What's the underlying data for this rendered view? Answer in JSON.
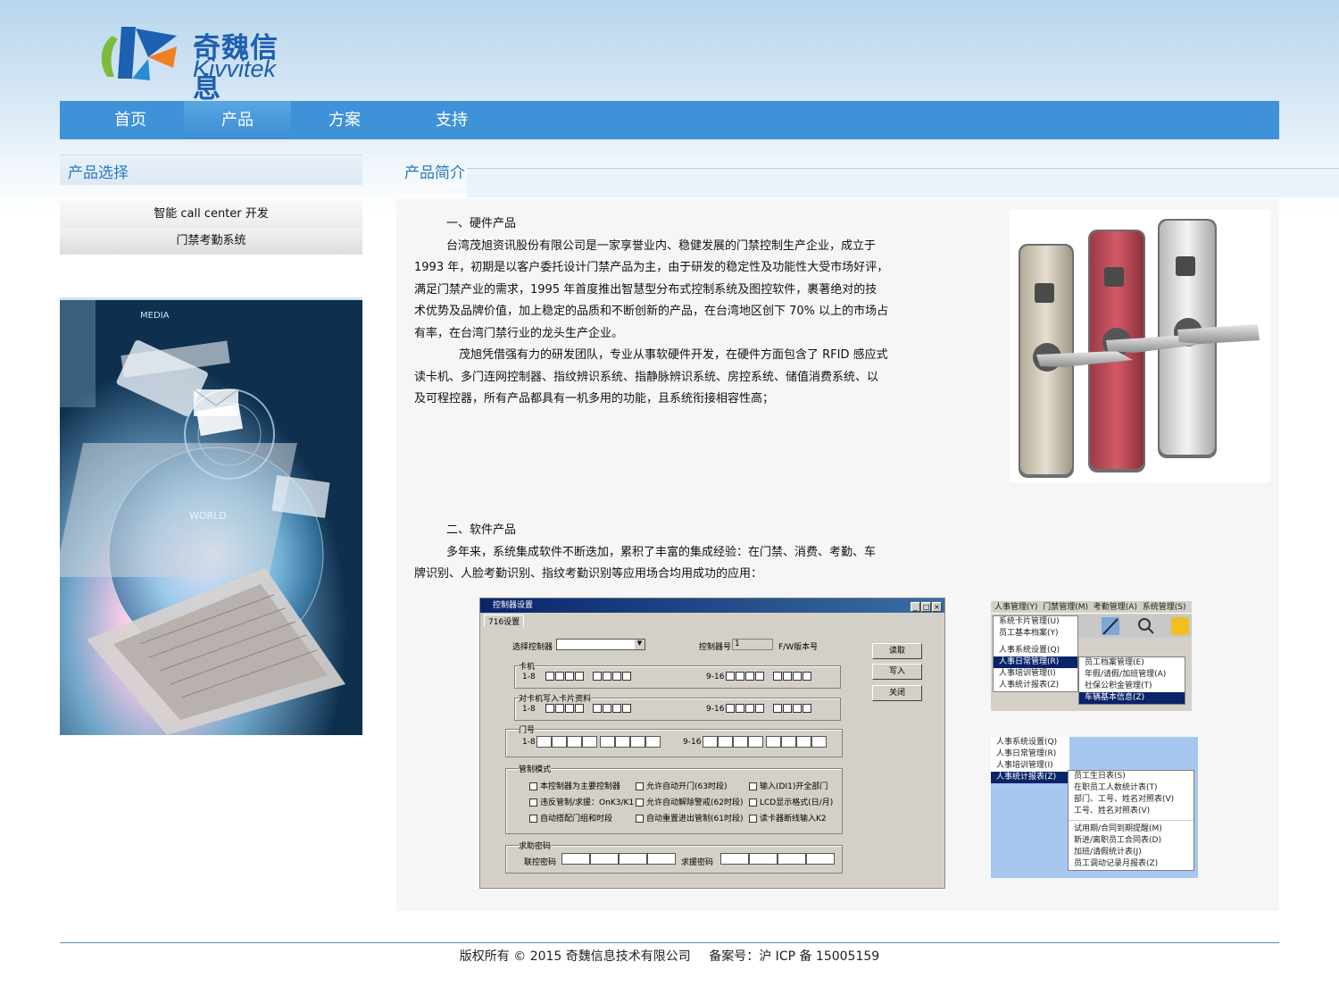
{
  "brand": {
    "name_cn": "奇魏信息",
    "name_en": "Kivvitek"
  },
  "nav": [
    {
      "label": "首页"
    },
    {
      "label": "产品"
    },
    {
      "label": "方案"
    },
    {
      "label": "支持"
    }
  ],
  "nav_active": "产品",
  "sidebar": {
    "title": "产品选择",
    "items": [
      {
        "label": "智能 call center 开发"
      },
      {
        "label": "门禁考勤系统"
      }
    ]
  },
  "main": {
    "title": "产品简介",
    "hardware": {
      "heading": "一、硬件产品",
      "lines1": [
        "台湾茂旭资讯股份有限公司是一家享誉业内、稳健发展的门禁控制生产企业，成立于",
        "1993 年，初期是以客户委托设计门禁产品为主，由于研发的稳定性及功能性大受市场好评，",
        "满足门禁产业的需求，1995 年首度推出智慧型分布式控制系统及图控软件，裹著绝对的技",
        "术优势及品牌价值，加上稳定的品质和不断创新的产品，在台湾地区创下 70% 以上的市场占",
        "有率，在台湾门禁行业的龙头生产企业。"
      ],
      "lines2": [
        "茂旭凭借强有力的研发团队，专业从事软硬件开发，在硬件方面包含了 RFID 感应式",
        "读卡机、多门连网控制器、指纹辨识系统、指静脉辨识系统、房控系统、储值消费系统、以",
        "及可程控器，所有产品都具有一机多用的功能，且系统衔接相容性高；"
      ]
    },
    "software": {
      "heading": "二、软件产品",
      "lines": [
        "多年来，系统集成软件不断迭加，累积了丰富的集成经验：在门禁、消费、考勤、车",
        "牌识别、人脸考勤识别、指纹考勤识别等应用场合均用成功的应用："
      ]
    }
  },
  "controller_window": {
    "title": "控制器设置",
    "tab": "716设置",
    "select_label": "选择控制器",
    "ctrl_no_label": "控制器号",
    "ctrl_no_value": "1",
    "fw_label": "F/W版本号",
    "buttons": [
      "读取",
      "写入",
      "关闭"
    ],
    "card_group": "卡机",
    "write_group": "对卡机写入卡片资料",
    "door_group": "门号",
    "range1": "1-8",
    "range2": "9-16",
    "mode_group": "管制模式",
    "modes": [
      "本控制器为主要控制器",
      "允许自动开门(63时段)",
      "输入(DI1)开全部门",
      "违反管制/求援：OnK3/K1",
      "允许自动解除警戒(62时段)",
      "LCD显示格式(日/月)",
      "自动搭配门组和时段",
      "自动重置进出管制(61时段)",
      "读卡器断线输入K2"
    ],
    "pw_group": "求助密码",
    "pw1": "联控密码",
    "pw2": "求援密码"
  },
  "menu_shot_1": {
    "bar": [
      "人事管理(Y)",
      "门禁管理(M)",
      "考勤管理(A)",
      "系统管理(S)"
    ],
    "items": [
      "系统卡片管理(U)",
      "员工基本档案(Y)",
      "人事系统设置(Q)",
      "人事日常管理(R)",
      "人事培训管理(I)",
      "人事统计报表(Z)"
    ],
    "sub": [
      "员工档案管理(E)",
      "年假/请假/加班管理(A)",
      "社保公积金管理(T)",
      "车辆基本信息(Z)"
    ]
  },
  "menu_shot_2": {
    "items": [
      "人事系统设置(Q)",
      "人事日常管理(R)",
      "人事培训管理(I)",
      "人事统计报表(Z)"
    ],
    "sub": [
      "员工生日表(S)",
      "在职员工人数统计表(T)",
      "部门、工号、姓名对照表(V)",
      "工号、姓名对照表(V)",
      "试用期/合同到期提醒(M)",
      "新进/离职员工合同表(D)",
      "加班/请假统计表(J)",
      "员工调动记录月报表(Z)"
    ]
  },
  "footer": {
    "copyright": "版权所有 © 2015 奇魏信息技术有限公司",
    "icp": "备案号：沪 ICP 备 15005159"
  },
  "colors": {
    "nav": "#3f92d8",
    "accent": "#2a79c2",
    "brand": "#1d5fb0"
  }
}
